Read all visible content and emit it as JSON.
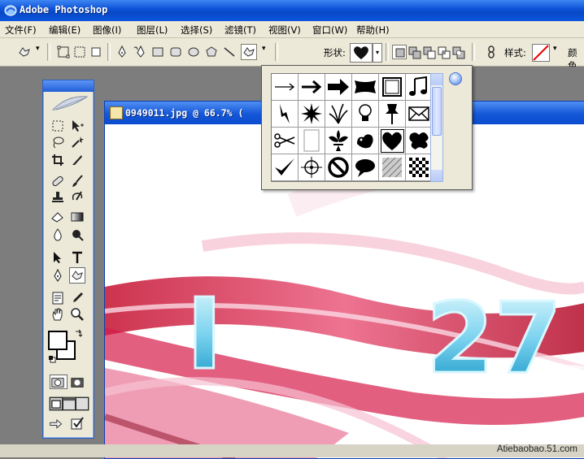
{
  "app": {
    "title": "Adobe Photoshop"
  },
  "menubar": {
    "items": [
      "文件(F)",
      "编辑(E)",
      "图像(I)",
      "图层(L)",
      "选择(S)",
      "滤镜(T)",
      "视图(V)",
      "窗口(W)",
      "帮助(H)"
    ]
  },
  "options_bar": {
    "shape_label": "形状:",
    "style_label": "样式:",
    "color_label": "颜色"
  },
  "document": {
    "title": "0949011.jpg @ 66.7% (",
    "canvas_text_left": "I",
    "canvas_text_right": "27"
  },
  "shape_picker": {
    "shapes": [
      "arrow-thin",
      "arrow-medium",
      "arrow-bold",
      "banner",
      "frame",
      "music-note",
      "lightning",
      "starburst",
      "grass",
      "lightbulb",
      "pushpin",
      "envelope",
      "scissors",
      "blank-page",
      "fleur-de-lis",
      "bird",
      "heart",
      "splat",
      "checkmark",
      "crosshair",
      "no-symbol",
      "speech-bubble",
      "hatch-pattern",
      "checker-pattern"
    ],
    "selected": "heart"
  },
  "watermark": "Atiebaobao.51.com"
}
